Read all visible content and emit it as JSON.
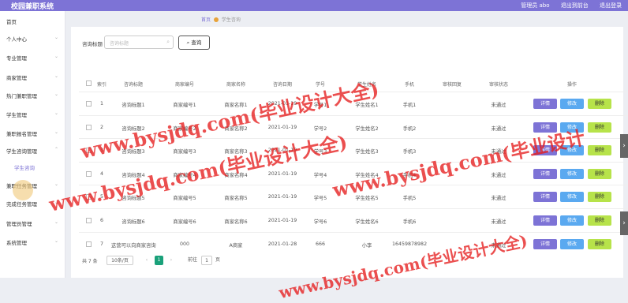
{
  "app": {
    "title": "校园兼职系统",
    "user": "管理员 abo",
    "back": "退出到前台",
    "logout": "退出登录"
  },
  "menu": [
    {
      "label": "首页",
      "chev": ""
    },
    {
      "label": "个人中心",
      "chev": "⌄"
    },
    {
      "label": "专业管理",
      "chev": "⌄"
    },
    {
      "label": "商家管理",
      "chev": "⌄"
    },
    {
      "label": "热门兼职管理",
      "chev": "⌄"
    },
    {
      "label": "学生管理",
      "chev": "⌄"
    },
    {
      "label": "兼职报名管理",
      "chev": "⌄"
    },
    {
      "label": "学生咨询管理",
      "chev": "⌃"
    },
    {
      "label": "学生咨询",
      "chev": ""
    },
    {
      "label": "兼职任务管理",
      "chev": "⌄"
    },
    {
      "label": "完成任务管理",
      "chev": "⌄"
    },
    {
      "label": "管理员管理",
      "chev": "⌄"
    },
    {
      "label": "系统管理",
      "chev": "⌄"
    }
  ],
  "breadcrumb": {
    "home": "首页",
    "current": "学生咨询"
  },
  "search": {
    "label": "咨询标题",
    "placeholder": "咨询标题",
    "button": "查询"
  },
  "table": {
    "headers": [
      "索引",
      "咨询标题",
      "商家编号",
      "商家名称",
      "咨询日期",
      "学号",
      "学生姓名",
      "手机",
      "审核回复",
      "审核状态",
      "操作"
    ],
    "rows": [
      [
        "1",
        "咨询标题1",
        "商家编号1",
        "商家名称1",
        "2021-01-19",
        "学号1",
        "学生姓名1",
        "手机1",
        "",
        "未通过"
      ],
      [
        "2",
        "咨询标题2",
        "商家编号2",
        "商家名称2",
        "2021-01-19",
        "学号2",
        "学生姓名2",
        "手机2",
        "",
        "未通过"
      ],
      [
        "3",
        "咨询标题3",
        "商家编号3",
        "商家名称3",
        "2021-01-19",
        "学号3",
        "学生姓名3",
        "手机3",
        "",
        "未通过"
      ],
      [
        "4",
        "咨询标题4",
        "商家编号4",
        "商家名称4",
        "2021-01-19",
        "学号4",
        "学生姓名4",
        "手机4",
        "",
        "未通过"
      ],
      [
        "5",
        "咨询标题5",
        "商家编号5",
        "商家名称5",
        "2021-01-19",
        "学号5",
        "学生姓名5",
        "手机5",
        "",
        "未通过"
      ],
      [
        "6",
        "咨询标题6",
        "商家编号6",
        "商家名称6",
        "2021-01-19",
        "学号6",
        "学生姓名6",
        "手机6",
        "",
        "未通过"
      ],
      [
        "7",
        "这营可以向商家咨询",
        "000",
        "A商家",
        "2021-01-28",
        "666",
        "小李",
        "16459878982",
        "",
        "未通过"
      ]
    ],
    "actions": {
      "detail": "详情",
      "edit": "修改",
      "delete": "删除"
    }
  },
  "pagination": {
    "total": "共 7 条",
    "size": "10条/页",
    "current": "1",
    "goto": "前往",
    "page": "1",
    "unit": "页"
  },
  "watermark": [
    "www.bysjdq.com(毕业设计大全)",
    "www.bysjdq.com(毕业设计"
  ]
}
